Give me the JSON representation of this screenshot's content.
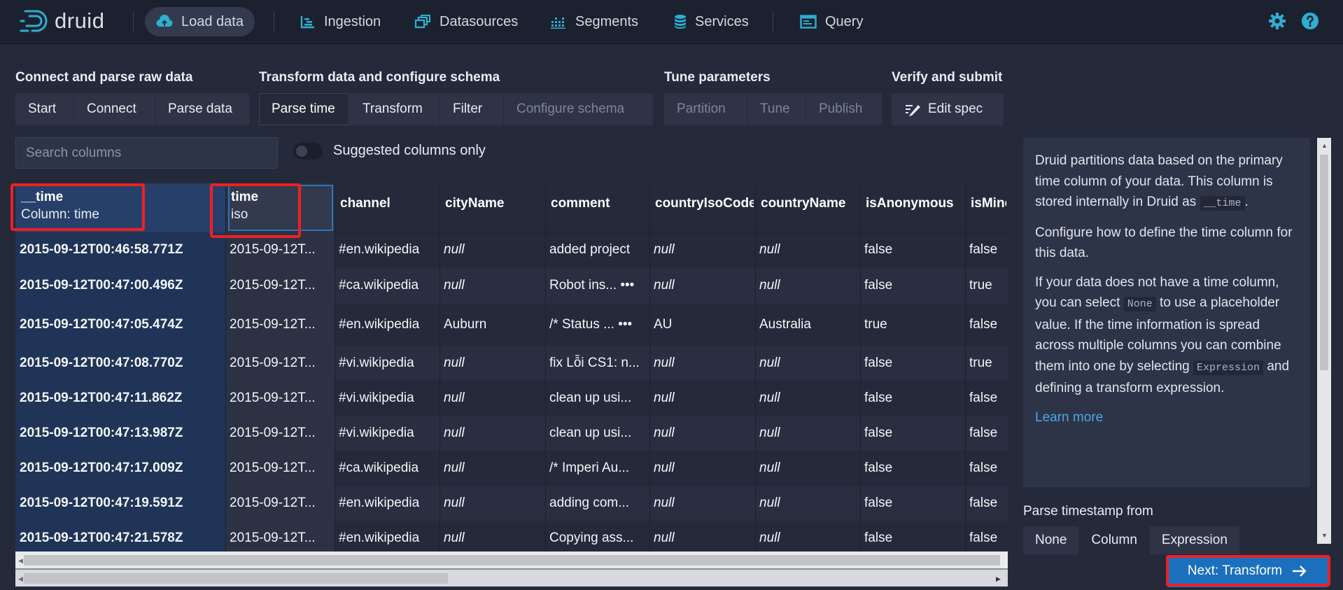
{
  "app": {
    "brand": "druid"
  },
  "nav": {
    "load_data": "Load data",
    "ingestion": "Ingestion",
    "datasources": "Datasources",
    "segments": "Segments",
    "services": "Services",
    "query": "Query"
  },
  "steps": {
    "group1": {
      "title": "Connect and parse raw data",
      "buttons": [
        "Start",
        "Connect",
        "Parse data"
      ]
    },
    "group2": {
      "title": "Transform data and configure schema",
      "buttons": [
        "Parse time",
        "Transform",
        "Filter",
        "Configure schema"
      ]
    },
    "group3": {
      "title": "Tune parameters",
      "buttons": [
        "Partition",
        "Tune",
        "Publish"
      ]
    },
    "group4": {
      "title": "Verify and submit",
      "buttons": [
        "Edit spec"
      ]
    }
  },
  "search": {
    "placeholder": "Search columns"
  },
  "suggested_toggle": {
    "label": "Suggested columns only",
    "on": false
  },
  "table": {
    "columns": [
      {
        "name": "__time",
        "sub": "Column: time"
      },
      {
        "name": "time",
        "sub": "iso"
      },
      {
        "name": "channel",
        "sub": ""
      },
      {
        "name": "cityName",
        "sub": ""
      },
      {
        "name": "comment",
        "sub": ""
      },
      {
        "name": "countryIsoCode",
        "sub": ""
      },
      {
        "name": "countryName",
        "sub": ""
      },
      {
        "name": "isAnonymous",
        "sub": ""
      },
      {
        "name": "isMinor",
        "sub": ""
      }
    ],
    "rows": [
      [
        "2015-09-12T00:46:58.771Z",
        "2015-09-12T...",
        "#en.wikipedia",
        "null",
        "added project",
        "null",
        "null",
        "false",
        "false"
      ],
      [
        "2015-09-12T00:47:00.496Z",
        "2015-09-12T...",
        "#ca.wikipedia",
        "null",
        "Robot ins... •••",
        "null",
        "null",
        "false",
        "true"
      ],
      [
        "2015-09-12T00:47:05.474Z",
        "2015-09-12T...",
        "#en.wikipedia",
        "Auburn",
        "/* Status ... •••",
        "AU",
        "Australia",
        "true",
        "false"
      ],
      [
        "2015-09-12T00:47:08.770Z",
        "2015-09-12T...",
        "#vi.wikipedia",
        "null",
        "fix Lỗi CS1: n...",
        "null",
        "null",
        "false",
        "true"
      ],
      [
        "2015-09-12T00:47:11.862Z",
        "2015-09-12T...",
        "#vi.wikipedia",
        "null",
        "clean up usi...",
        "null",
        "null",
        "false",
        "false"
      ],
      [
        "2015-09-12T00:47:13.987Z",
        "2015-09-12T...",
        "#vi.wikipedia",
        "null",
        "clean up usi...",
        "null",
        "null",
        "false",
        "false"
      ],
      [
        "2015-09-12T00:47:17.009Z",
        "2015-09-12T...",
        "#ca.wikipedia",
        "null",
        "/* Imperi Au...",
        "null",
        "null",
        "false",
        "false"
      ],
      [
        "2015-09-12T00:47:19.591Z",
        "2015-09-12T...",
        "#en.wikipedia",
        "null",
        "adding com...",
        "null",
        "null",
        "false",
        "false"
      ],
      [
        "2015-09-12T00:47:21.578Z",
        "2015-09-12T...",
        "#en.wikipedia",
        "null",
        "Copying ass...",
        "null",
        "null",
        "false",
        "false"
      ]
    ]
  },
  "sidebar": {
    "p1_a": "Druid partitions data based on the primary time column of your data. This column is stored internally in Druid as",
    "p1_code": "__time",
    "p1_b": ".",
    "p2": "Configure how to define the time column for this data.",
    "p3_a": "If your data does not have a time column, you can select",
    "p3_code1": "None",
    "p3_b": "to use a placeholder value. If the time information is spread across multiple columns you can combine them into one by selecting",
    "p3_code2": "Expression",
    "p3_c": "and defining a transform expression.",
    "learn_more": "Learn more"
  },
  "parse_from": {
    "label": "Parse timestamp from",
    "options": [
      "None",
      "Column",
      "Expression"
    ],
    "selected": "Column"
  },
  "next_button": {
    "label": "Next: Transform"
  },
  "colors": {
    "accent": "#1b6fbd",
    "highlight": "#ef2024",
    "icon": "#2eaed0"
  }
}
